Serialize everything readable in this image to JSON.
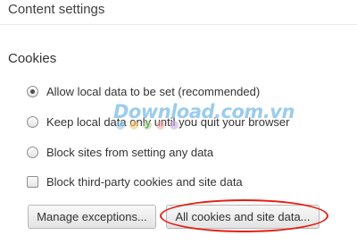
{
  "header": {
    "title": "Content settings"
  },
  "cookies": {
    "section_title": "Cookies",
    "options": [
      {
        "label": "Allow local data to be set (recommended)",
        "type": "radio",
        "checked": true
      },
      {
        "label": "Keep local data only until you quit your browser",
        "type": "radio",
        "checked": false
      },
      {
        "label": "Block sites from setting any data",
        "type": "radio",
        "checked": false
      },
      {
        "label": "Block third-party cookies and site data",
        "type": "checkbox",
        "checked": false
      }
    ],
    "buttons": {
      "manage_exceptions": "Manage exceptions...",
      "all_cookies": "All cookies and site data..."
    }
  },
  "annotation": {
    "highlight_color": "#e41e13"
  },
  "watermark": {
    "text": "Download.com.vn",
    "text_color": "#4aa3df",
    "dot_colors": [
      "#8ec6ea",
      "#f2c46a",
      "#9fd38a",
      "#f2a3a3",
      "#c9a7e3"
    ]
  }
}
